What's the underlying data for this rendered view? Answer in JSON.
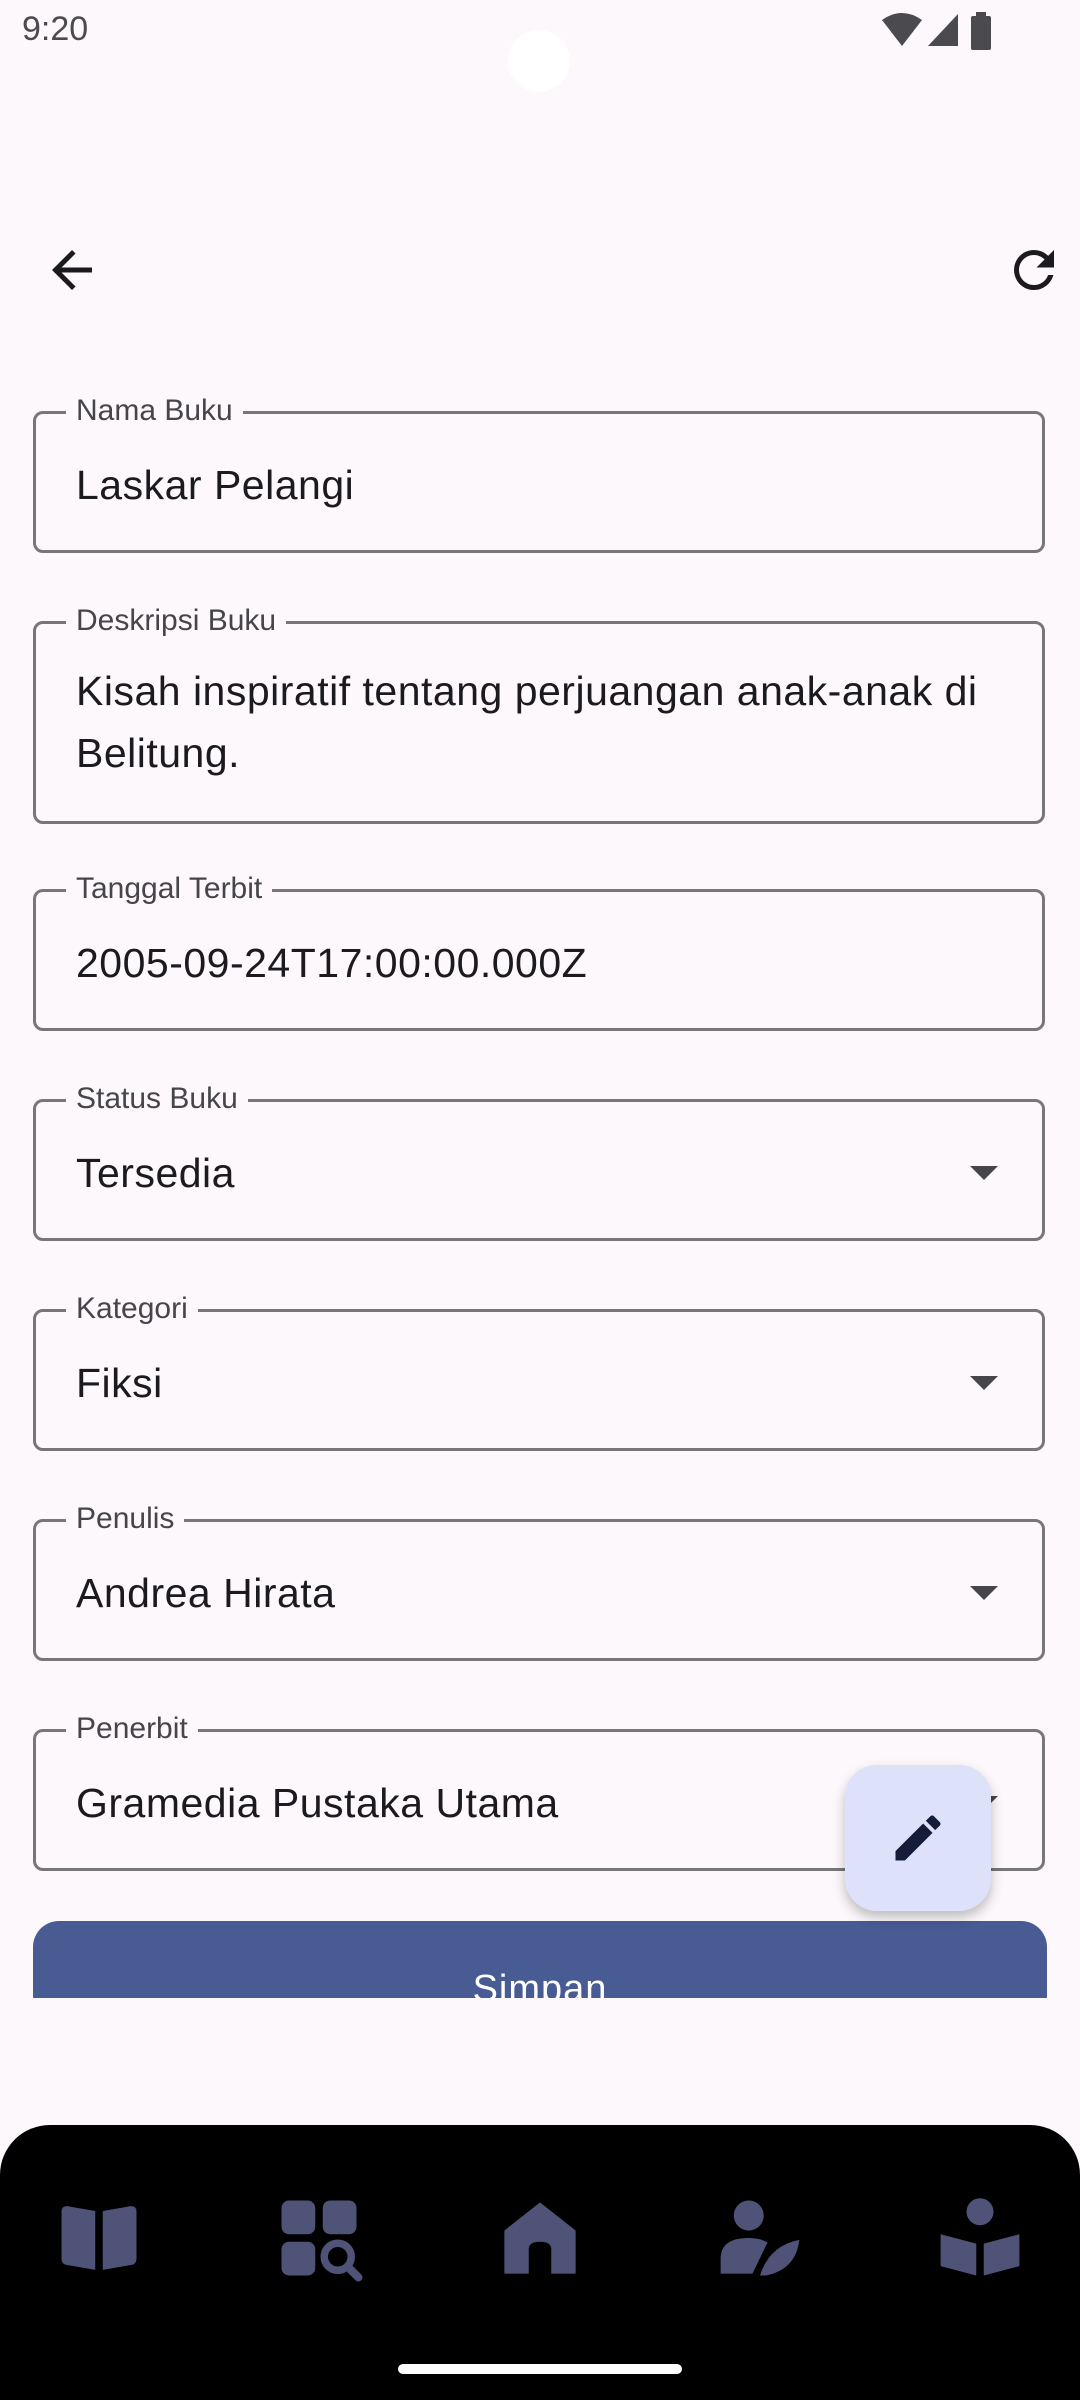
{
  "status_bar": {
    "time": "9:20"
  },
  "top_bar": {
    "back_icon": "arrow-back-icon",
    "refresh_icon": "refresh-icon"
  },
  "form": {
    "nama_buku": {
      "label": "Nama Buku",
      "value": "Laskar Pelangi"
    },
    "deskripsi_buku": {
      "label": "Deskripsi Buku",
      "value": "Kisah inspiratif tentang perjuangan anak-anak di Belitung."
    },
    "tanggal_terbit": {
      "label": "Tanggal Terbit",
      "value": "2005-09-24T17:00:00.000Z"
    },
    "status_buku": {
      "label": "Status Buku",
      "value": "Tersedia"
    },
    "kategori": {
      "label": "Kategori",
      "value": "Fiksi"
    },
    "penulis": {
      "label": "Penulis",
      "value": "Andrea Hirata"
    },
    "penerbit": {
      "label": "Penerbit",
      "value": "Gramedia Pustaka Utama"
    },
    "save_label": "Simpan"
  },
  "fab": {
    "icon": "edit-pencil-icon"
  },
  "bottom_nav": {
    "items": [
      {
        "icon": "book-icon"
      },
      {
        "icon": "category-search-icon"
      },
      {
        "icon": "home-icon"
      },
      {
        "icon": "author-icon"
      },
      {
        "icon": "reader-icon"
      }
    ]
  },
  "colors": {
    "background": "#fcf8fb",
    "outline": "#77767b",
    "primary_button": "#485b92",
    "fab_container": "#dde1f9",
    "nav_bar": "#000000",
    "nav_icon": "#4f5377"
  }
}
